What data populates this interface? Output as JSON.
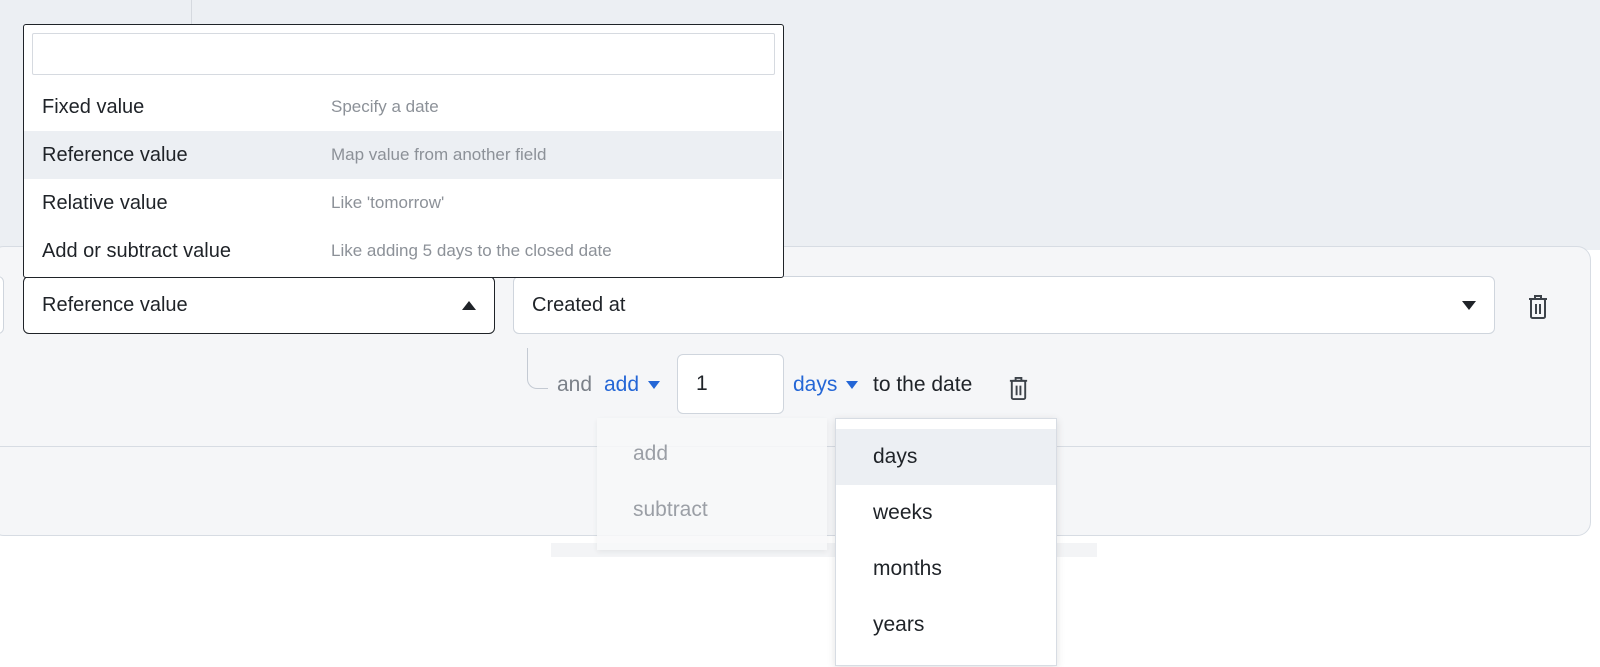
{
  "type_select": {
    "value": "Reference value",
    "options": [
      {
        "label": "Fixed value",
        "description": "Specify a date"
      },
      {
        "label": "Reference value",
        "description": "Map value from another field"
      },
      {
        "label": "Relative value",
        "description": "Like 'tomorrow'"
      },
      {
        "label": "Add or subtract value",
        "description": "Like adding 5 days to the closed date"
      }
    ],
    "search_value": ""
  },
  "field_select": {
    "value": "Created at"
  },
  "modifier": {
    "conjunction": "and",
    "operation": "add",
    "amount": "1",
    "unit": "days",
    "suffix": "to the date"
  },
  "operation_menu": {
    "options": [
      "add",
      "subtract"
    ]
  },
  "unit_menu": {
    "options": [
      "days",
      "weeks",
      "months",
      "years"
    ],
    "highlighted": "days"
  },
  "icons": {
    "trash": "trash-icon",
    "caret_up": "caret-up-icon",
    "caret_down": "caret-down-icon"
  },
  "colors": {
    "link": "#2466d6",
    "highlight": "#eceff3",
    "border_active": "#1f2328"
  }
}
